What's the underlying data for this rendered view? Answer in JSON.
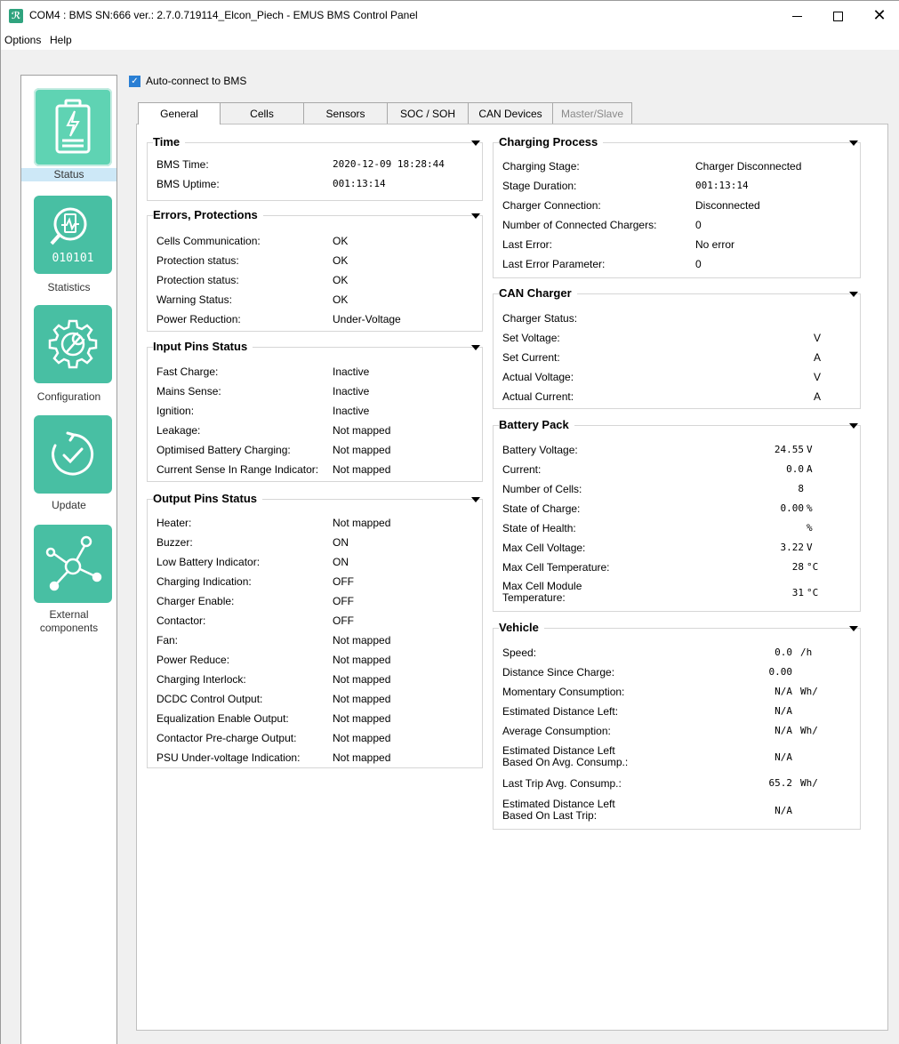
{
  "window": {
    "title": "COM4 : BMS SN:666 ver.: 2.7.0.719114_Elcon_Piech - EMUS BMS Control Panel",
    "app_icon_glyph": "ℛ"
  },
  "menu": {
    "options": "Options",
    "help": "Help"
  },
  "sidebar": {
    "items": [
      {
        "label": "Status",
        "icon": "battery-bolt-icon"
      },
      {
        "label": "Statistics",
        "icon": "statistics-icon",
        "tile_text": "010101"
      },
      {
        "label": "Configuration",
        "icon": "gear-wrench-icon"
      },
      {
        "label": "Update",
        "icon": "update-check-icon"
      },
      {
        "label": "External",
        "label2": "components",
        "icon": "network-nodes-icon"
      }
    ]
  },
  "autoconnect": {
    "label": "Auto-connect to BMS",
    "checked": true
  },
  "tabs": [
    "General",
    "Cells",
    "Sensors",
    "SOC / SOH",
    "CAN Devices",
    "Master/Slave"
  ],
  "time": {
    "title": "Time",
    "rows": [
      {
        "label": "BMS Time:",
        "value": "2020-12-09 18:28:44"
      },
      {
        "label": "BMS Uptime:",
        "value": "001:13:14"
      }
    ]
  },
  "errors": {
    "title": "Errors, Protections",
    "rows": [
      {
        "label": "Cells Communication:",
        "value": "OK"
      },
      {
        "label": "Protection status:",
        "value": "OK"
      },
      {
        "label": "Protection status:",
        "value": "OK"
      },
      {
        "label": "Warning Status:",
        "value": "OK"
      },
      {
        "label": "Power Reduction:",
        "value": "Under-Voltage"
      }
    ]
  },
  "input_pins": {
    "title": "Input Pins Status",
    "rows": [
      {
        "label": "Fast Charge:",
        "value": "Inactive"
      },
      {
        "label": "Mains Sense:",
        "value": "Inactive"
      },
      {
        "label": "Ignition:",
        "value": "Inactive"
      },
      {
        "label": "Leakage:",
        "value": "Not mapped"
      },
      {
        "label": "Optimised Battery Charging:",
        "value": "Not mapped"
      },
      {
        "label": "Current Sense In Range Indicator:",
        "value": "Not mapped"
      }
    ]
  },
  "output_pins": {
    "title": "Output Pins Status",
    "rows": [
      {
        "label": "Heater:",
        "value": "Not mapped"
      },
      {
        "label": "Buzzer:",
        "value": "ON"
      },
      {
        "label": "Low Battery Indicator:",
        "value": "ON"
      },
      {
        "label": "Charging Indication:",
        "value": "OFF"
      },
      {
        "label": "Charger Enable:",
        "value": "OFF"
      },
      {
        "label": "Contactor:",
        "value": "OFF"
      },
      {
        "label": "Fan:",
        "value": "Not mapped"
      },
      {
        "label": "Power Reduce:",
        "value": "Not mapped"
      },
      {
        "label": "Charging Interlock:",
        "value": "Not mapped"
      },
      {
        "label": "DCDC Control Output:",
        "value": "Not mapped"
      },
      {
        "label": "Equalization Enable Output:",
        "value": "Not mapped"
      },
      {
        "label": "Contactor Pre-charge Output:",
        "value": "Not mapped"
      },
      {
        "label": "PSU Under-voltage Indication:",
        "value": "Not mapped"
      }
    ]
  },
  "charging_process": {
    "title": "Charging Process",
    "rows": [
      {
        "label": "Charging Stage:",
        "value": "Charger Disconnected"
      },
      {
        "label": "Stage Duration:",
        "value": "001:13:14"
      },
      {
        "label": "Charger Connection:",
        "value": "Disconnected"
      },
      {
        "label": "Number of Connected Chargers:",
        "value": "0"
      },
      {
        "label": "Last Error:",
        "value": "No error"
      },
      {
        "label": "Last Error Parameter:",
        "value": "0"
      }
    ]
  },
  "can_charger": {
    "title": "CAN Charger",
    "rows": [
      {
        "label": "Charger Status:",
        "value": "",
        "unit": ""
      },
      {
        "label": "Set Voltage:",
        "value": "",
        "unit": "V"
      },
      {
        "label": "Set Current:",
        "value": "",
        "unit": "A"
      },
      {
        "label": "Actual Voltage:",
        "value": "",
        "unit": "V"
      },
      {
        "label": "Actual Current:",
        "value": "",
        "unit": "A"
      }
    ]
  },
  "battery_pack": {
    "title": "Battery Pack",
    "rows": [
      {
        "label": "Battery Voltage:",
        "value": "24.55",
        "unit": "V"
      },
      {
        "label": "Current:",
        "value": "0.0",
        "unit": "A"
      },
      {
        "label": "Number of Cells:",
        "value": "8",
        "unit": ""
      },
      {
        "label": "State of Charge:",
        "value": "0.00",
        "unit": "%"
      },
      {
        "label": "State of Health:",
        "value": "",
        "unit": "%"
      },
      {
        "label": "Max Cell Voltage:",
        "value": "3.22",
        "unit": "V"
      },
      {
        "label": "Max Cell Temperature:",
        "value": "28",
        "unit": "°C"
      },
      {
        "label": "Max Cell Module",
        "label2": "Temperature:",
        "value": "31",
        "unit": "°C"
      }
    ]
  },
  "vehicle": {
    "title": "Vehicle",
    "rows": [
      {
        "label": "Speed:",
        "value": "0.0",
        "unit": "/h"
      },
      {
        "label": "Distance Since Charge:",
        "value": "0.00",
        "unit": ""
      },
      {
        "label": "Momentary Consumption:",
        "value": "N/A",
        "unit": "Wh/"
      },
      {
        "label": "Estimated Distance Left:",
        "value": "N/A",
        "unit": ""
      },
      {
        "label": "Average Consumption:",
        "value": "N/A",
        "unit": "Wh/"
      },
      {
        "label": "Estimated Distance Left",
        "label2": "Based On Avg. Consump.:",
        "value": "N/A",
        "unit": ""
      },
      {
        "label": "Last Trip Avg. Consump.:",
        "value": "65.2",
        "unit": "Wh/"
      },
      {
        "label": "Estimated Distance Left",
        "label2": "Based On Last Trip:",
        "value": "N/A",
        "unit": ""
      }
    ]
  },
  "colors": {
    "tile": "#48bfa3",
    "tile_active": "#5fd3b3",
    "selection": "#cde8f7",
    "checkbox": "#2a7fd4"
  }
}
